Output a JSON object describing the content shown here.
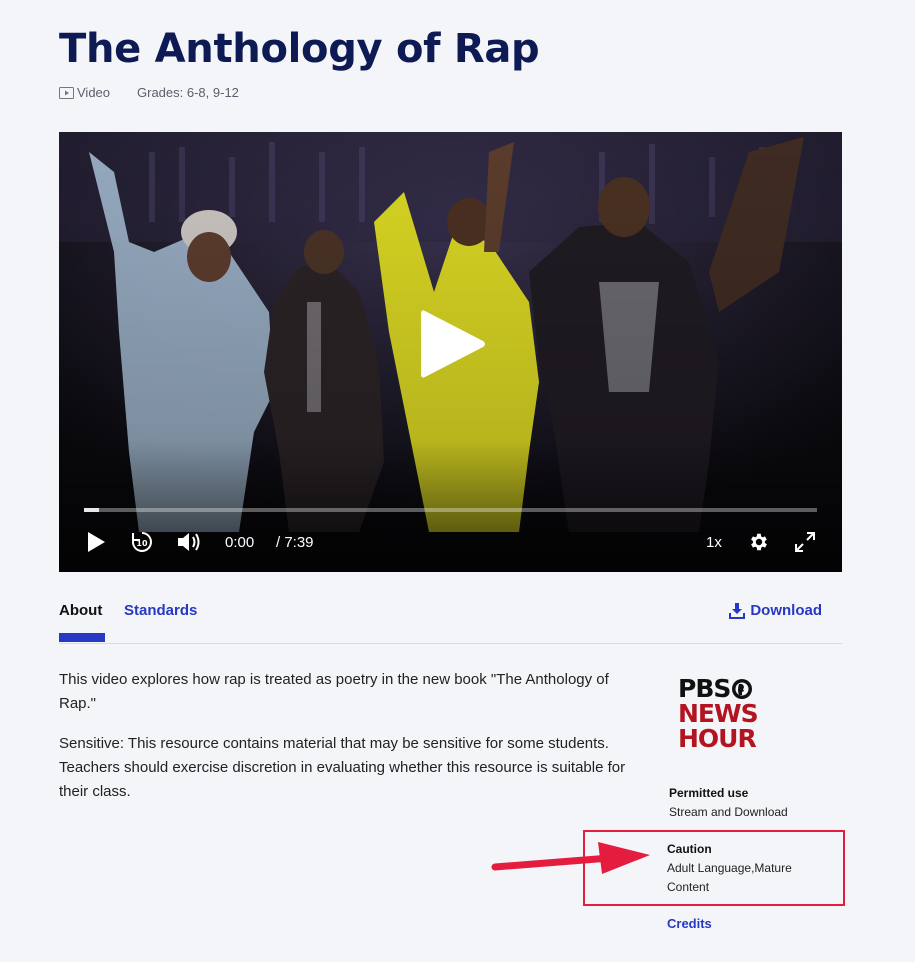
{
  "page": {
    "title": "The Anthology of Rap",
    "media_type": "Video",
    "grades": "Grades: 6-8, 9-12"
  },
  "player": {
    "current_time": "0:00",
    "duration": "/ 7:39",
    "speed": "1x",
    "progress_fraction": 0.02
  },
  "tabs": [
    {
      "label": "About",
      "active": true
    },
    {
      "label": "Standards",
      "active": false
    }
  ],
  "download_label": "Download",
  "description": [
    "This video explores how rap is treated as poetry in the new book \"The Anthology of Rap.\"",
    "Sensitive: This resource contains material that may be sensitive for some students. Teachers should exercise discretion in evaluating whether this resource is suitable for their class."
  ],
  "sidebar": {
    "logo": {
      "line1": "PBS",
      "line2": "NEWS",
      "line3": "HOUR"
    },
    "permitted_use_label": "Permitted use",
    "permitted_use_value": "Stream and Download",
    "caution_label": "Caution",
    "caution_value_line1": "Adult Language,Mature",
    "caution_value_line2": "Content",
    "credits_label": "Credits"
  },
  "colors": {
    "title": "#0e1a54",
    "link": "#2638c4",
    "highlight": "#e41d3e",
    "logo_red": "#b3141f"
  }
}
